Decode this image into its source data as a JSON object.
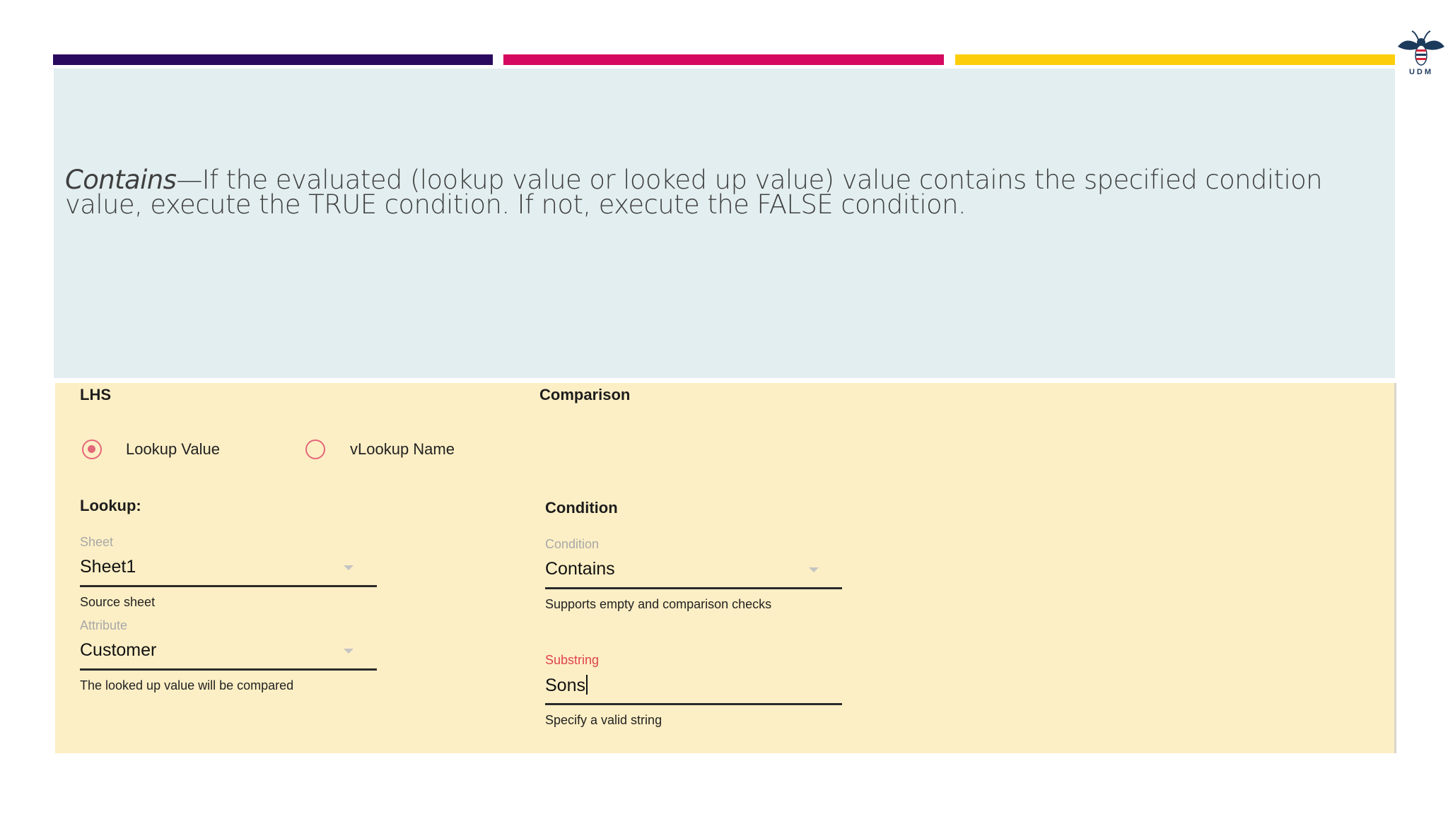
{
  "colors": {
    "bar_purple": "#2a0a5e",
    "bar_magenta": "#d4095f",
    "bar_yellow": "#fccd0b",
    "radio_accent": "#e5677a",
    "error_label": "#e0434d"
  },
  "logo": {
    "text": "UDM",
    "icon": "bee-logo-icon"
  },
  "description": {
    "term": "Contains",
    "dash": "—",
    "text": "If the evaluated (lookup value or looked up value) value contains the specified condition value, execute the TRUE condition. If not, execute the FALSE condition."
  },
  "form": {
    "lhs_heading": "LHS",
    "comparison_heading": "Comparison",
    "radio_options": [
      {
        "label": "Lookup Value",
        "selected": true
      },
      {
        "label": "vLookup Name",
        "selected": false
      }
    ],
    "lookup_heading": "Lookup:",
    "sheet": {
      "label": "Sheet",
      "value": "Sheet1",
      "helper": "Source sheet"
    },
    "attribute": {
      "label": "Attribute",
      "value": "Customer",
      "helper": "The looked up value will be compared"
    },
    "condition_heading": "Condition",
    "condition": {
      "label": "Condition",
      "value": "Contains",
      "helper": "Supports empty and comparison checks"
    },
    "substring": {
      "label": "Substring",
      "value": "Sons",
      "helper": "Specify a valid string"
    }
  }
}
